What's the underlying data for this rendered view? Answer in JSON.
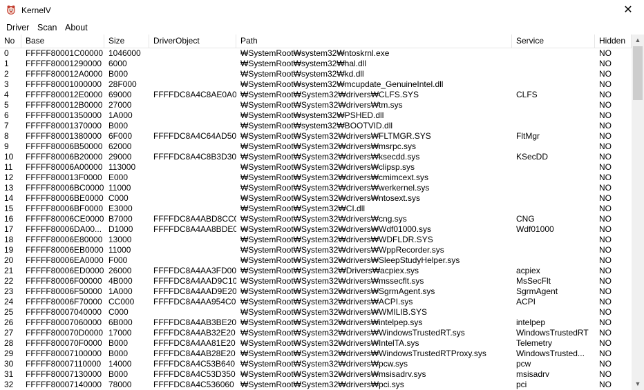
{
  "window": {
    "title": "KernelV",
    "close_glyph": "✕"
  },
  "menu": [
    "Driver",
    "Scan",
    "About"
  ],
  "columns": [
    "No",
    "Base",
    "Size",
    "DriverObject",
    "Path",
    "Service",
    "Hidden"
  ],
  "rows": [
    [
      "0",
      "FFFFF80001C00000",
      "1046000",
      "",
      "₩SystemRoot₩system32₩ntoskrnl.exe",
      "",
      "NO"
    ],
    [
      "1",
      "FFFFF80001290000",
      "6000",
      "",
      "₩SystemRoot₩system32₩hal.dll",
      "",
      "NO"
    ],
    [
      "2",
      "FFFFF800012A0000",
      "B000",
      "",
      "₩SystemRoot₩system32₩kd.dll",
      "",
      "NO"
    ],
    [
      "3",
      "FFFFF80001000000",
      "28F000",
      "",
      "₩SystemRoot₩system32₩mcupdate_GenuineIntel.dll",
      "",
      "NO"
    ],
    [
      "4",
      "FFFFF800012E0000",
      "69000",
      "FFFFDC8A4C8AE0A0",
      "₩SystemRoot₩System32₩drivers₩CLFS.SYS",
      "CLFS",
      "NO"
    ],
    [
      "5",
      "FFFFF800012B0000",
      "27000",
      "",
      "₩SystemRoot₩System32₩drivers₩tm.sys",
      "",
      "NO"
    ],
    [
      "6",
      "FFFFF80001350000",
      "1A000",
      "",
      "₩SystemRoot₩system32₩PSHED.dll",
      "",
      "NO"
    ],
    [
      "7",
      "FFFFF80001370000",
      "B000",
      "",
      "₩SystemRoot₩system32₩BOOTVID.dll",
      "",
      "NO"
    ],
    [
      "8",
      "FFFFF80001380000",
      "6F000",
      "FFFFDC8A4C64AD50",
      "₩SystemRoot₩System32₩drivers₩FLTMGR.SYS",
      "FltMgr",
      "NO"
    ],
    [
      "9",
      "FFFFF80006B50000",
      "62000",
      "",
      "₩SystemRoot₩System32₩drivers₩msrpc.sys",
      "",
      "NO"
    ],
    [
      "10",
      "FFFFF80006B20000",
      "29000",
      "FFFFDC8A4C8B3D30",
      "₩SystemRoot₩System32₩drivers₩ksecdd.sys",
      "KSecDD",
      "NO"
    ],
    [
      "11",
      "FFFFF80006A00000",
      "113000",
      "",
      "₩SystemRoot₩System32₩drivers₩clipsp.sys",
      "",
      "NO"
    ],
    [
      "12",
      "FFFFF800013F0000",
      "E000",
      "",
      "₩SystemRoot₩System32₩drivers₩cmimcext.sys",
      "",
      "NO"
    ],
    [
      "13",
      "FFFFF80006BC0000",
      "11000",
      "",
      "₩SystemRoot₩System32₩drivers₩werkernel.sys",
      "",
      "NO"
    ],
    [
      "14",
      "FFFFF80006BE0000",
      "C000",
      "",
      "₩SystemRoot₩System32₩drivers₩ntosext.sys",
      "",
      "NO"
    ],
    [
      "15",
      "FFFFF80006BF0000",
      "E3000",
      "",
      "₩SystemRoot₩System32₩CI.dll",
      "",
      "NO"
    ],
    [
      "16",
      "FFFFF80006CE0000",
      "B7000",
      "FFFFDC8A4ABD8CC0",
      "₩SystemRoot₩System32₩drivers₩cng.sys",
      "CNG",
      "NO"
    ],
    [
      "17",
      "FFFFF80006DA00...",
      "D1000",
      "FFFFDC8A4AA8BDE0",
      "₩SystemRoot₩System32₩drivers₩Wdf01000.sys",
      "Wdf01000",
      "NO"
    ],
    [
      "18",
      "FFFFF80006E80000",
      "13000",
      "",
      "₩SystemRoot₩System32₩drivers₩WDFLDR.SYS",
      "",
      "NO"
    ],
    [
      "19",
      "FFFFF80006EB0000",
      "11000",
      "",
      "₩SystemRoot₩System32₩drivers₩WppRecorder.sys",
      "",
      "NO"
    ],
    [
      "20",
      "FFFFF80006EA0000",
      "F000",
      "",
      "₩SystemRoot₩System32₩drivers₩SleepStudyHelper.sys",
      "",
      "NO"
    ],
    [
      "21",
      "FFFFF80006ED0000",
      "26000",
      "FFFFDC8A4AA3FD00",
      "₩SystemRoot₩System32₩Drivers₩acpiex.sys",
      "acpiex",
      "NO"
    ],
    [
      "22",
      "FFFFF80006F00000",
      "4B000",
      "FFFFDC8A4AAD9C10",
      "₩SystemRoot₩System32₩drivers₩mssecflt.sys",
      "MsSecFlt",
      "NO"
    ],
    [
      "23",
      "FFFFF80006F50000",
      "1A000",
      "FFFFDC8A4AAD9E20",
      "₩SystemRoot₩System32₩drivers₩SgrmAgent.sys",
      "SgrmAgent",
      "NO"
    ],
    [
      "24",
      "FFFFF80006F70000",
      "CC000",
      "FFFFDC8A4AA954C0",
      "₩SystemRoot₩System32₩drivers₩ACPI.sys",
      "ACPI",
      "NO"
    ],
    [
      "25",
      "FFFFF80007040000",
      "C000",
      "",
      "₩SystemRoot₩System32₩drivers₩WMILIB.SYS",
      "",
      "NO"
    ],
    [
      "26",
      "FFFFF80007060000",
      "6B000",
      "FFFFDC8A4AB3BE20",
      "₩SystemRoot₩System32₩drivers₩intelpep.sys",
      "intelpep",
      "NO"
    ],
    [
      "27",
      "FFFFF800070D0000",
      "17000",
      "FFFFDC8A4AB32E20",
      "₩SystemRoot₩System32₩drivers₩WindowsTrustedRT.sys",
      "WindowsTrustedRT",
      "NO"
    ],
    [
      "28",
      "FFFFF800070F0000",
      "B000",
      "FFFFDC8A4AA81E20",
      "₩SystemRoot₩System32₩drivers₩IntelTA.sys",
      "Telemetry",
      "NO"
    ],
    [
      "29",
      "FFFFF80007100000",
      "B000",
      "FFFFDC8A4AB28E20",
      "₩SystemRoot₩System32₩drivers₩WindowsTrustedRTProxy.sys",
      "WindowsTrusted...",
      "NO"
    ],
    [
      "30",
      "FFFFF80007110000",
      "14000",
      "FFFFDC8A4C53B640",
      "₩SystemRoot₩System32₩drivers₩pcw.sys",
      "pcw",
      "NO"
    ],
    [
      "31",
      "FFFFF80007130000",
      "B000",
      "FFFFDC8A4C53D350",
      "₩SystemRoot₩System32₩drivers₩msisadrv.sys",
      "msisadrv",
      "NO"
    ],
    [
      "32",
      "FFFFF80007140000",
      "78000",
      "FFFFDC8A4C536060",
      "₩SystemRoot₩System32₩drivers₩pci.sys",
      "pci",
      "NO"
    ]
  ],
  "scrollbar": {
    "up_glyph": "▲",
    "down_glyph": "▼"
  }
}
